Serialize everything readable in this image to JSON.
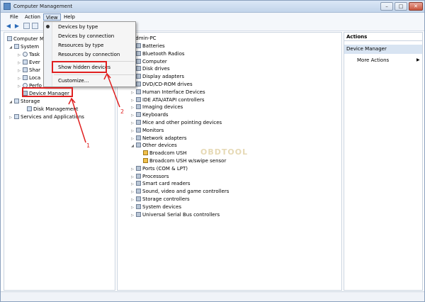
{
  "window": {
    "title": "Computer Management",
    "controls": [
      "–",
      "□",
      "✕"
    ]
  },
  "menubar": {
    "items": [
      "File",
      "Action",
      "View",
      "Help"
    ]
  },
  "view_menu": {
    "items": [
      "Devices by type",
      "Devices by connection",
      "Resources by type",
      "Resources by connection",
      "Show hidden devices",
      "Customize..."
    ]
  },
  "left_tree": {
    "root": "Computer M",
    "system": "System",
    "sub": [
      "Task",
      "Ever",
      "Shar",
      "Loca",
      "Perfo"
    ],
    "device_manager": "Device Manager",
    "storage": "Storage",
    "disk_management": "Disk Management",
    "services": "Services and Applications"
  },
  "device_tree": {
    "root": "admin-PC",
    "items": [
      "Batteries",
      "Bluetooth Radios",
      "Computer",
      "Disk drives",
      "Display adapters",
      "DVD/CD-ROM drives",
      "Human Interface Devices",
      "IDE ATA/ATAPI controllers",
      "Imaging devices",
      "Keyboards",
      "Mice and other pointing devices",
      "Monitors",
      "Network adapters",
      "Other devices",
      "Broadcom USH",
      "Broadcom USH w/swipe sensor",
      "Ports (COM & LPT)",
      "Processors",
      "Smart card readers",
      "Sound, video and game controllers",
      "Storage controllers",
      "System devices",
      "Universal Serial Bus controllers"
    ]
  },
  "actions": {
    "header": "Actions",
    "section": "Device Manager",
    "more": "More Actions"
  },
  "annotations": {
    "one": "1",
    "two": "2"
  },
  "watermark": "OBDTOOL",
  "colors": {
    "highlight": "#e02020",
    "accent": "#2b6bb8"
  }
}
